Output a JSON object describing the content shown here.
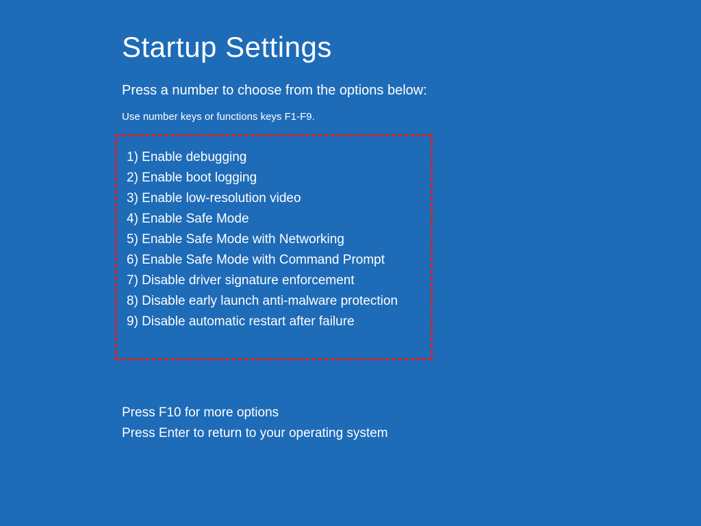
{
  "title": "Startup Settings",
  "subtitle": "Press a number to choose from the options below:",
  "hint": "Use number keys or functions keys F1-F9.",
  "options": [
    "1) Enable debugging",
    "2) Enable boot logging",
    "3) Enable low-resolution video",
    "4) Enable Safe Mode",
    "5) Enable Safe Mode with Networking",
    "6) Enable Safe Mode with Command Prompt",
    "7) Disable driver signature enforcement",
    "8) Disable early launch anti-malware protection",
    "9) Disable automatic restart after failure"
  ],
  "footer": {
    "line1": "Press F10 for more options",
    "line2": "Press Enter to return to your operating system"
  }
}
